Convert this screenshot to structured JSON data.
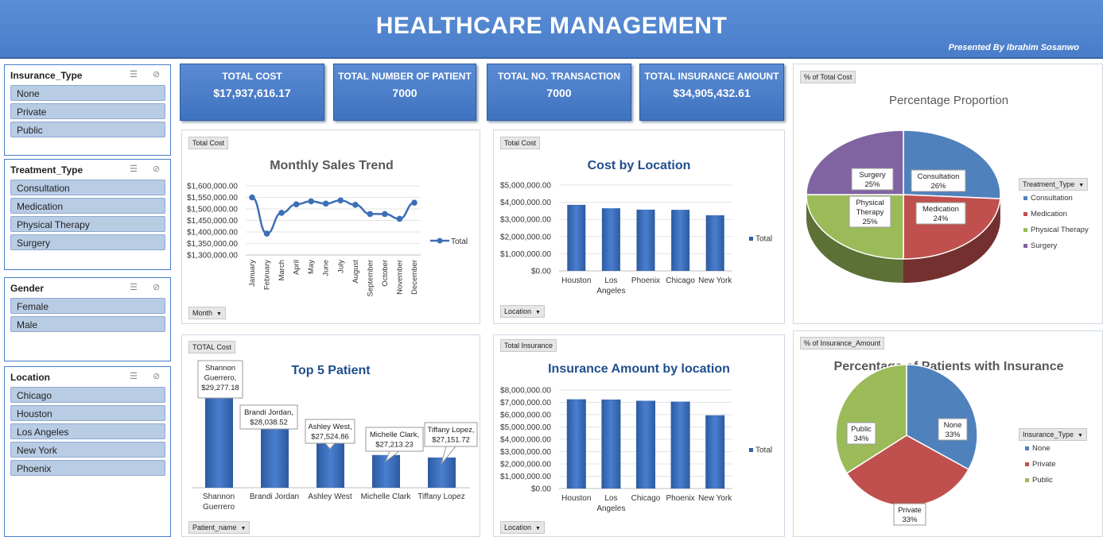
{
  "header": {
    "title": "HEALTHCARE MANAGEMENT",
    "presenter": "Presented By Ibrahim Sosanwo"
  },
  "slicers": [
    {
      "title": "Insurance_Type",
      "items": [
        "None",
        "Private",
        "Public"
      ]
    },
    {
      "title": "Treatment_Type",
      "items": [
        "Consultation",
        "Medication",
        "Physical Therapy",
        "Surgery"
      ]
    },
    {
      "title": "Gender",
      "items": [
        "Female",
        "Male"
      ]
    },
    {
      "title": "Location",
      "items": [
        "Chicago",
        "Houston",
        "Los Angeles",
        "New York",
        "Phoenix"
      ]
    }
  ],
  "kpis": [
    {
      "title": "TOTAL COST",
      "value": "$17,937,616.17"
    },
    {
      "title": "TOTAL NUMBER OF PATIENT",
      "value": "7000"
    },
    {
      "title": "TOTAL  NO. TRANSACTION",
      "value": "7000"
    },
    {
      "title": "TOTAL INSURANCE AMOUNT",
      "value": "$34,905,432.61"
    }
  ],
  "chart_data": [
    {
      "type": "line",
      "field_button": "Total Cost",
      "title": "Monthly Sales Trend",
      "axis_button": "Month",
      "categories": [
        "January",
        "February",
        "March",
        "April",
        "May",
        "June",
        "July",
        "August",
        "September",
        "October",
        "November",
        "December"
      ],
      "series": [
        {
          "name": "Total",
          "values": [
            1550000,
            1393000,
            1483000,
            1520000,
            1533000,
            1523000,
            1537000,
            1518000,
            1478000,
            1478000,
            1457000,
            1527000
          ]
        }
      ],
      "ylim": [
        1300000,
        1600000
      ],
      "yticks": [
        "$1,600,000.00",
        "$1,550,000.00",
        "$1,500,000.00",
        "$1,450,000.00",
        "$1,400,000.00",
        "$1,350,000.00",
        "$1,300,000.00"
      ],
      "legend": "right",
      "color": "#3d6fb6"
    },
    {
      "type": "bar",
      "field_button": "Total Cost",
      "title": "Cost by Location",
      "axis_button": "Location",
      "categories": [
        "Houston",
        "Los Angeles",
        "Phoenix",
        "Chicago",
        "New York"
      ],
      "series": [
        {
          "name": "Total",
          "values": [
            3850000,
            3650000,
            3570000,
            3560000,
            3240000
          ]
        }
      ],
      "ylim": [
        0,
        5000000
      ],
      "yticks": [
        "$5,000,000.00",
        "$4,000,000.00",
        "$3,000,000.00",
        "$2,000,000.00",
        "$1,000,000.00",
        "$0.00"
      ],
      "legend": "right",
      "color": "#2f5fa8"
    },
    {
      "type": "pie",
      "field_button": "% of Total Cost",
      "title": "Percentage Proportion",
      "legend_title": "Treatment_Type",
      "slices": [
        {
          "label": "Consultation",
          "value": 26,
          "display": "26%",
          "color": "#4f81bd"
        },
        {
          "label": "Medication",
          "value": 24,
          "display": "24%",
          "color": "#c0504d"
        },
        {
          "label": "Physical Therapy",
          "value": 25,
          "display": "25%",
          "color": "#9bbb59"
        },
        {
          "label": "Surgery",
          "value": 25,
          "display": "25%",
          "color": "#8064a2"
        }
      ]
    },
    {
      "type": "bar",
      "field_button": "TOTAL Cost",
      "title": "Top 5 Patient",
      "axis_button": "Patient_name",
      "categories": [
        "Shannon Guerrero",
        "Brandi Jordan",
        "Ashley West",
        "Michelle Clark",
        "Tiffany Lopez"
      ],
      "values": [
        29277.18,
        28038.52,
        27524.86,
        27213.23,
        27151.72
      ],
      "data_labels": [
        "Shannon Guerrero, $29,277.18",
        "Brandi Jordan, $28,038.52",
        "Ashley West, $27,524.86",
        "Michelle Clark, $27,213.23",
        "Tiffany Lopez, $27,151.72"
      ],
      "ylim": [
        26400,
        29400
      ],
      "color": "#2f5fa8"
    },
    {
      "type": "bar",
      "field_button": "Total Insurance",
      "title": "Insurance Amount by location",
      "axis_button": "Location",
      "categories": [
        "Houston",
        "Los Angeles",
        "Chicago",
        "Phoenix",
        "New York"
      ],
      "series": [
        {
          "name": "Total",
          "values": [
            7250000,
            7230000,
            7130000,
            7060000,
            5950000
          ]
        }
      ],
      "ylim": [
        0,
        8000000
      ],
      "yticks": [
        "$8,000,000.00",
        "$7,000,000.00",
        "$6,000,000.00",
        "$5,000,000.00",
        "$4,000,000.00",
        "$3,000,000.00",
        "$2,000,000.00",
        "$1,000,000.00",
        "$0.00"
      ],
      "legend": "right",
      "color": "#2f5fa8"
    },
    {
      "type": "pie",
      "field_button": "% of Insurance_Amount",
      "title": "Percentage of Patients with Insurance",
      "legend_title": "Insurance_Type",
      "slices": [
        {
          "label": "None",
          "value": 33,
          "display": "33%",
          "color": "#4f81bd"
        },
        {
          "label": "Private",
          "value": 33,
          "display": "33%",
          "color": "#c0504d"
        },
        {
          "label": "Public",
          "value": 34,
          "display": "34%",
          "color": "#9bbb59"
        }
      ]
    }
  ]
}
